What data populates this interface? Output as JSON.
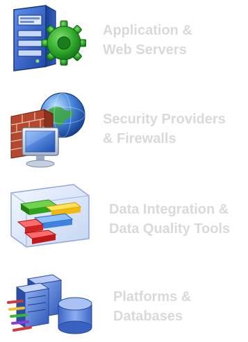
{
  "items": [
    {
      "icon": "server-gear-icon",
      "line1": "Application &",
      "line2": "Web Servers"
    },
    {
      "icon": "firewall-globe-monitor-icon",
      "line1": "Security Providers",
      "line2": "& Firewalls"
    },
    {
      "icon": "data-blocks-cube-icon",
      "line1": "Data Integration &",
      "line2": "Data Quality Tools"
    },
    {
      "icon": "servers-database-icon",
      "line1": "Platforms &",
      "line2": "Databases"
    }
  ],
  "colors": {
    "label": "#d9d9d9",
    "server_blue": "#2f63c8",
    "gear_green": "#33b52c",
    "brick_red": "#b6462c",
    "globe_blue": "#3f7fd6",
    "cube_frame": "#9fb7e6"
  }
}
